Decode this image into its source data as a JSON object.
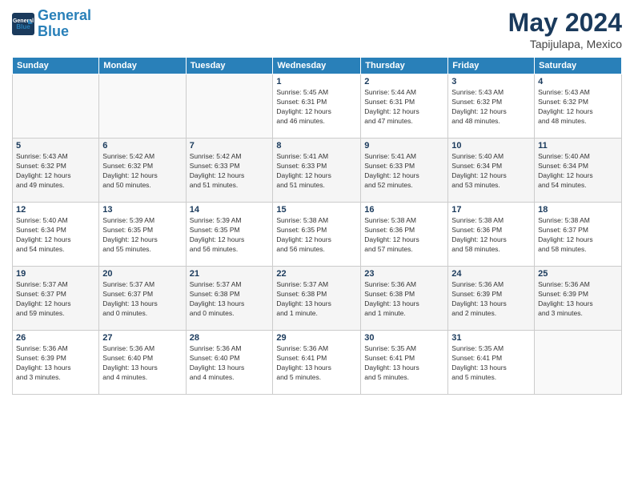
{
  "header": {
    "logo_line1": "General",
    "logo_line2": "Blue",
    "month_year": "May 2024",
    "location": "Tapijulapa, Mexico"
  },
  "days_of_week": [
    "Sunday",
    "Monday",
    "Tuesday",
    "Wednesday",
    "Thursday",
    "Friday",
    "Saturday"
  ],
  "weeks": [
    [
      {
        "day": "",
        "info": ""
      },
      {
        "day": "",
        "info": ""
      },
      {
        "day": "",
        "info": ""
      },
      {
        "day": "1",
        "info": "Sunrise: 5:45 AM\nSunset: 6:31 PM\nDaylight: 12 hours\nand 46 minutes."
      },
      {
        "day": "2",
        "info": "Sunrise: 5:44 AM\nSunset: 6:31 PM\nDaylight: 12 hours\nand 47 minutes."
      },
      {
        "day": "3",
        "info": "Sunrise: 5:43 AM\nSunset: 6:32 PM\nDaylight: 12 hours\nand 48 minutes."
      },
      {
        "day": "4",
        "info": "Sunrise: 5:43 AM\nSunset: 6:32 PM\nDaylight: 12 hours\nand 48 minutes."
      }
    ],
    [
      {
        "day": "5",
        "info": "Sunrise: 5:43 AM\nSunset: 6:32 PM\nDaylight: 12 hours\nand 49 minutes."
      },
      {
        "day": "6",
        "info": "Sunrise: 5:42 AM\nSunset: 6:32 PM\nDaylight: 12 hours\nand 50 minutes."
      },
      {
        "day": "7",
        "info": "Sunrise: 5:42 AM\nSunset: 6:33 PM\nDaylight: 12 hours\nand 51 minutes."
      },
      {
        "day": "8",
        "info": "Sunrise: 5:41 AM\nSunset: 6:33 PM\nDaylight: 12 hours\nand 51 minutes."
      },
      {
        "day": "9",
        "info": "Sunrise: 5:41 AM\nSunset: 6:33 PM\nDaylight: 12 hours\nand 52 minutes."
      },
      {
        "day": "10",
        "info": "Sunrise: 5:40 AM\nSunset: 6:34 PM\nDaylight: 12 hours\nand 53 minutes."
      },
      {
        "day": "11",
        "info": "Sunrise: 5:40 AM\nSunset: 6:34 PM\nDaylight: 12 hours\nand 54 minutes."
      }
    ],
    [
      {
        "day": "12",
        "info": "Sunrise: 5:40 AM\nSunset: 6:34 PM\nDaylight: 12 hours\nand 54 minutes."
      },
      {
        "day": "13",
        "info": "Sunrise: 5:39 AM\nSunset: 6:35 PM\nDaylight: 12 hours\nand 55 minutes."
      },
      {
        "day": "14",
        "info": "Sunrise: 5:39 AM\nSunset: 6:35 PM\nDaylight: 12 hours\nand 56 minutes."
      },
      {
        "day": "15",
        "info": "Sunrise: 5:38 AM\nSunset: 6:35 PM\nDaylight: 12 hours\nand 56 minutes."
      },
      {
        "day": "16",
        "info": "Sunrise: 5:38 AM\nSunset: 6:36 PM\nDaylight: 12 hours\nand 57 minutes."
      },
      {
        "day": "17",
        "info": "Sunrise: 5:38 AM\nSunset: 6:36 PM\nDaylight: 12 hours\nand 58 minutes."
      },
      {
        "day": "18",
        "info": "Sunrise: 5:38 AM\nSunset: 6:37 PM\nDaylight: 12 hours\nand 58 minutes."
      }
    ],
    [
      {
        "day": "19",
        "info": "Sunrise: 5:37 AM\nSunset: 6:37 PM\nDaylight: 12 hours\nand 59 minutes."
      },
      {
        "day": "20",
        "info": "Sunrise: 5:37 AM\nSunset: 6:37 PM\nDaylight: 13 hours\nand 0 minutes."
      },
      {
        "day": "21",
        "info": "Sunrise: 5:37 AM\nSunset: 6:38 PM\nDaylight: 13 hours\nand 0 minutes."
      },
      {
        "day": "22",
        "info": "Sunrise: 5:37 AM\nSunset: 6:38 PM\nDaylight: 13 hours\nand 1 minute."
      },
      {
        "day": "23",
        "info": "Sunrise: 5:36 AM\nSunset: 6:38 PM\nDaylight: 13 hours\nand 1 minute."
      },
      {
        "day": "24",
        "info": "Sunrise: 5:36 AM\nSunset: 6:39 PM\nDaylight: 13 hours\nand 2 minutes."
      },
      {
        "day": "25",
        "info": "Sunrise: 5:36 AM\nSunset: 6:39 PM\nDaylight: 13 hours\nand 3 minutes."
      }
    ],
    [
      {
        "day": "26",
        "info": "Sunrise: 5:36 AM\nSunset: 6:39 PM\nDaylight: 13 hours\nand 3 minutes."
      },
      {
        "day": "27",
        "info": "Sunrise: 5:36 AM\nSunset: 6:40 PM\nDaylight: 13 hours\nand 4 minutes."
      },
      {
        "day": "28",
        "info": "Sunrise: 5:36 AM\nSunset: 6:40 PM\nDaylight: 13 hours\nand 4 minutes."
      },
      {
        "day": "29",
        "info": "Sunrise: 5:36 AM\nSunset: 6:41 PM\nDaylight: 13 hours\nand 5 minutes."
      },
      {
        "day": "30",
        "info": "Sunrise: 5:35 AM\nSunset: 6:41 PM\nDaylight: 13 hours\nand 5 minutes."
      },
      {
        "day": "31",
        "info": "Sunrise: 5:35 AM\nSunset: 6:41 PM\nDaylight: 13 hours\nand 5 minutes."
      },
      {
        "day": "",
        "info": ""
      }
    ]
  ]
}
